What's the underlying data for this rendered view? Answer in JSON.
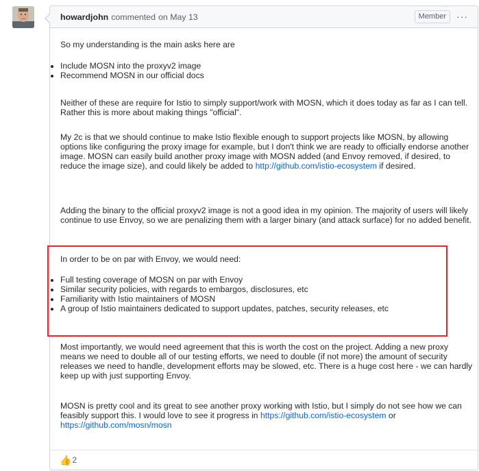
{
  "comment": {
    "author": "howardjohn",
    "action": "commented",
    "date": "on May 13",
    "badge": "Member",
    "more_icon": "kebab-horizontal-icon",
    "paragraph1": "So my understanding is the main asks here are",
    "list1": [
      "Include MOSN into the proxyv2 image",
      "Recommend MOSN in our official docs"
    ],
    "paragraph2": "Neither of these are require for Istio to simply support/work with MOSN, which it does today as far as I can tell. Rather this is more about making things \"official\".",
    "paragraph3_text": "My 2c is that we should continue to make Istio flexible enough to support projects like MOSN, by allowing options like configuring the proxy image for example, but I don't think we are ready to officially endorse another image. MOSN can easily build another proxy image with MOSN added (and Envoy removed, if desired, to reduce the image size), and could likely be added to ",
    "paragraph3_link": "http://github.com/istio-ecosystem",
    "paragraph3_suffix": " if desired.",
    "paragraph4": "Adding the binary to the official proxyv2 image is not a good idea in my opinion. The majority of users will likely continue to use Envoy, so we are penalizing them with a larger binary (and attack surface) for no added benefit.",
    "paragraph5": "In order to be on par with Envoy, we would need:",
    "list2": [
      "Full testing coverage of MOSN on par with Envoy",
      "Similar security policies, with regards to embargos, disclosures, etc",
      "Familiarity with Istio maintainers of MOSN",
      "A group of Istio maintainers dedicated to support updates, patches, security releases, etc"
    ],
    "paragraph6": "Most importantly, we would need agreement that this is worth the cost on the project. Adding a new proxy means we need to double all of our testing efforts, we need to double (if not more) the amount of security releases we need to handle, development efforts may be slowed, etc. There is a huge cost here - we can hardly keep up with just supporting Envoy.",
    "paragraph7_text": "MOSN is pretty cool and its great to see another proxy working with Istio, but I simply do not see how we can feasibly support this. I would love to see it progress in ",
    "paragraph7_link1": "https://github.com/istio-ecosystem",
    "paragraph7_or": " or",
    "paragraph7_link2": "https://github.com/mosn/mosn",
    "reactions": {
      "thumbs_up_icon": "thumbs-up-icon",
      "thumbs_up_count": "2"
    }
  },
  "colors": {
    "highlight_border": "#e8262a",
    "link": "#0366d6"
  }
}
